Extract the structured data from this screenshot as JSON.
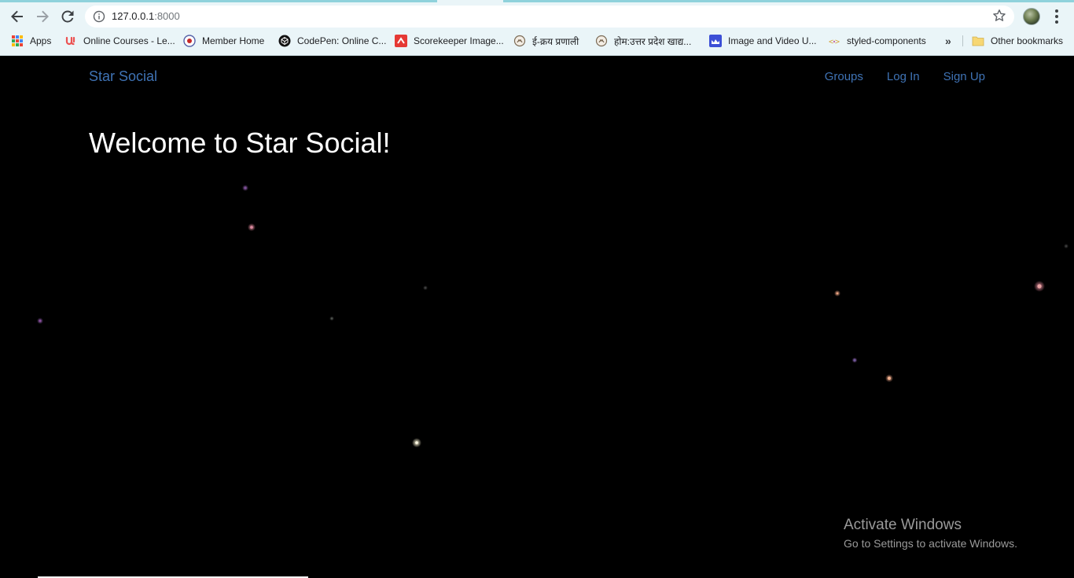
{
  "browser": {
    "url_host": "127.0.0.1",
    "url_port": ":8000",
    "bookmarks": [
      {
        "label": "Apps",
        "icon": "apps-grid-icon"
      },
      {
        "label": "Online Courses - Le...",
        "icon": "udemy-icon",
        "color": "#ec5252"
      },
      {
        "label": "Member Home",
        "icon": "member-seal-icon"
      },
      {
        "label": "CodePen: Online C...",
        "icon": "codepen-icon"
      },
      {
        "label": "Scorekeeper Image...",
        "icon": "scorekeeper-icon",
        "color": "#e53935"
      },
      {
        "label": "ई-क्रय प्रणाली",
        "icon": "emblem-icon"
      },
      {
        "label": "होम:उत्तर प्रदेश खाद्य...",
        "icon": "emblem-icon"
      },
      {
        "label": "Image and Video U...",
        "icon": "image-upload-icon",
        "color": "#3c4fd6"
      },
      {
        "label": "styled-components",
        "icon": "styled-components-icon"
      }
    ],
    "more_label": "»",
    "other_bookmarks": "Other bookmarks"
  },
  "site": {
    "brand": "Star Social",
    "nav": [
      {
        "label": "Groups"
      },
      {
        "label": "Log In"
      },
      {
        "label": "Sign Up"
      }
    ],
    "hero_title": "Welcome to Star Social!"
  },
  "watermark": {
    "line1": "Activate Windows",
    "line2": "Go to Settings to activate Windows."
  },
  "colors": {
    "link": "#3f73b5",
    "background": "#000000",
    "chrome": "#eaf5f8"
  }
}
